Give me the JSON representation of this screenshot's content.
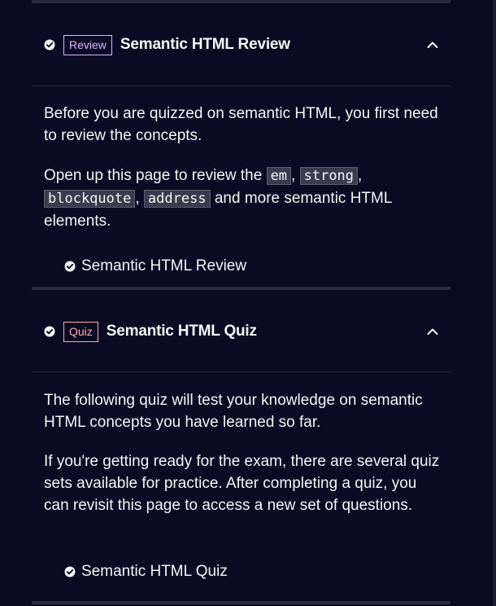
{
  "review_block": {
    "badge": "Review",
    "title": "Semantic HTML Review",
    "para1": "Before you are quizzed on semantic HTML, you first need to review the concepts.",
    "para2_prefix": "Open up this page to review the ",
    "code1": "em",
    "sep1": ", ",
    "code2": "strong",
    "sep2": ", ",
    "code3": "blockquote",
    "sep3": ", ",
    "code4": "address",
    "para2_suffix": " and more semantic HTML elements.",
    "link_label": "Semantic HTML Review"
  },
  "quiz_block": {
    "badge": "Quiz",
    "title": "Semantic HTML Quiz",
    "para1": "The following quiz will test your knowledge on semantic HTML concepts you have learned so far.",
    "para2": "If you're getting ready for the exam, there are several quiz sets available for practice. After completing a quiz, you can revisit this page to access a new set of questions.",
    "link_label": "Semantic HTML Quiz"
  },
  "icons": {
    "completed": "check-circle-icon",
    "collapse": "chevron-up-icon"
  },
  "colors": {
    "background": "#0a0a23",
    "review_badge": "#dbb8ff",
    "quiz_badge": "#ffadad",
    "code_bg": "#3b3b4f",
    "text": "#f5f6f7"
  }
}
